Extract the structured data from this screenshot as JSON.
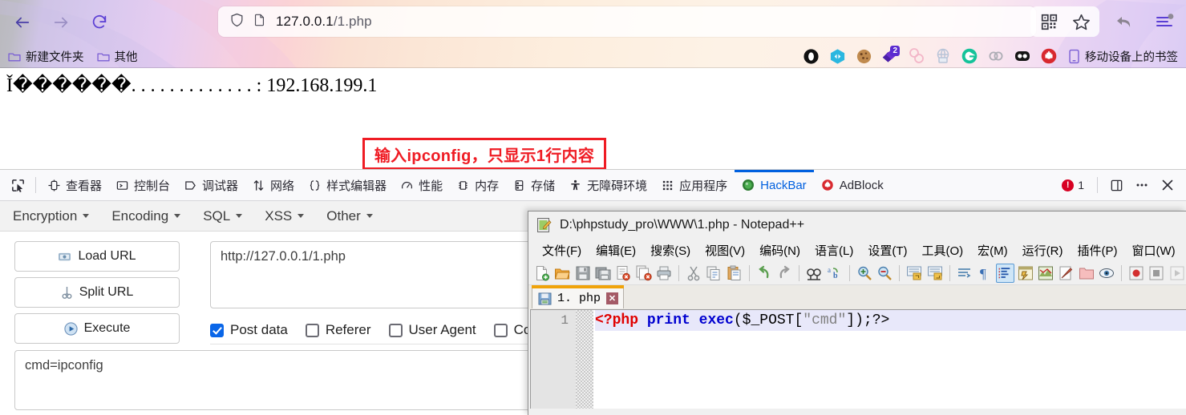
{
  "browser": {
    "url_prefix": "127.0.0.1",
    "url_suffix": "/1.php",
    "nav": {
      "back": "back-arrow",
      "forward": "forward-arrow",
      "reload": "reload"
    },
    "bookmarks": [
      {
        "label": "新建文件夹",
        "icon": "folder-icon"
      },
      {
        "label": "其他",
        "icon": "folder-icon"
      }
    ],
    "mobile_bookmarks_label": "移动设备上的书签",
    "extension_badge": "2"
  },
  "page": {
    "output_line": "Ǐ������. . . . . . . . . . . . . : 192.168.199.1",
    "annotation": "输入ipconfig，只显示1行内容",
    "annotation_color": "#ef1c24"
  },
  "devtools": {
    "tabs": [
      {
        "label": "查看器",
        "icon": "inspector-icon",
        "active": false
      },
      {
        "label": "控制台",
        "icon": "console-icon",
        "active": false
      },
      {
        "label": "调试器",
        "icon": "debugger-icon",
        "active": false
      },
      {
        "label": "网络",
        "icon": "network-icon",
        "active": false
      },
      {
        "label": "样式编辑器",
        "icon": "style-editor-icon",
        "active": false
      },
      {
        "label": "性能",
        "icon": "performance-icon",
        "active": false
      },
      {
        "label": "内存",
        "icon": "memory-icon",
        "active": false
      },
      {
        "label": "存储",
        "icon": "storage-icon",
        "active": false
      },
      {
        "label": "无障碍环境",
        "icon": "accessibility-icon",
        "active": false
      },
      {
        "label": "应用程序",
        "icon": "application-icon",
        "active": false
      },
      {
        "label": "HackBar",
        "icon": "hackbar-icon",
        "active": true
      },
      {
        "label": "AdBlock",
        "icon": "adblock-icon",
        "active": false
      }
    ],
    "error_count": "1",
    "accent": "#0060df"
  },
  "hackbar": {
    "menus": [
      "Encryption",
      "Encoding",
      "SQL",
      "XSS",
      "Other"
    ],
    "buttons": [
      {
        "label": "Load URL",
        "icon": "load-url-icon"
      },
      {
        "label": "Split URL",
        "icon": "scissors-icon"
      },
      {
        "label": "Execute",
        "icon": "play-icon"
      }
    ],
    "url_value": "http://127.0.0.1/1.php",
    "checkboxes": [
      {
        "label": "Post data",
        "checked": true
      },
      {
        "label": "Referer",
        "checked": false
      },
      {
        "label": "User Agent",
        "checked": false
      },
      {
        "label": "Co",
        "checked": false
      }
    ],
    "post_data_value": "cmd=ipconfig"
  },
  "notepad": {
    "title": "D:\\phpstudy_pro\\WWW\\1.php - Notepad++",
    "menus": [
      "文件(F)",
      "编辑(E)",
      "搜索(S)",
      "视图(V)",
      "编码(N)",
      "语言(L)",
      "设置(T)",
      "工具(O)",
      "宏(M)",
      "运行(R)",
      "插件(P)",
      "窗口(W)",
      "?"
    ],
    "tab_label": "1. php",
    "tab_close": "✕",
    "line_number": "1",
    "code": {
      "open_tag": "<?php ",
      "kw_print": "print",
      "space1": " ",
      "kw_exec": "exec",
      "paren_open": "($_POST[",
      "string": "\"cmd\"",
      "tail": "]);?>"
    }
  }
}
